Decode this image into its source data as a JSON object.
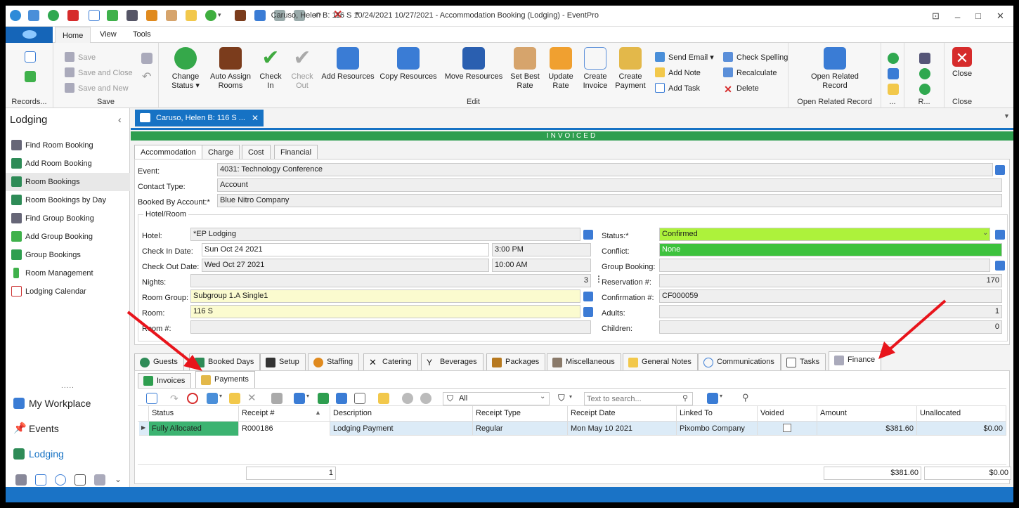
{
  "window": {
    "title": "Caruso, Helen B: 116 S 10/24/2021 10/27/2021  - Accommodation Booking (Lodging) - EventPro"
  },
  "ribbon_tabs": [
    "Home",
    "View",
    "Tools"
  ],
  "ribbon": {
    "groups": {
      "records": "Records...",
      "save": "Save",
      "edit": "Edit",
      "open_related": "Open Related Record",
      "g1": "...",
      "g2": "R...",
      "close": "Close"
    },
    "save": "Save",
    "save_close": "Save and Close",
    "save_new": "Save and New",
    "change_status": [
      "Change",
      "Status ▾"
    ],
    "auto_assign": [
      "Auto Assign",
      "Rooms"
    ],
    "check_in": [
      "Check",
      "In"
    ],
    "check_out": [
      "Check",
      "Out"
    ],
    "add_resources": "Add Resources",
    "copy_resources": "Copy Resources",
    "move_resources": "Move Resources",
    "set_best_rate": [
      "Set Best",
      "Rate"
    ],
    "update_rate": [
      "Update",
      "Rate"
    ],
    "create_invoice": [
      "Create",
      "Invoice"
    ],
    "create_payment": [
      "Create",
      "Payment"
    ],
    "send_email": "Send Email ▾",
    "add_note": "Add Note",
    "add_task": "Add Task",
    "check_spelling": "Check Spelling",
    "recalculate": "Recalculate",
    "delete": "Delete",
    "open_related": [
      "Open Related",
      "Record"
    ],
    "close": "Close"
  },
  "sidebar": {
    "title": "Lodging",
    "items": [
      "Find Room Booking",
      "Add Room Booking",
      "Room Bookings",
      "Room Bookings by Day",
      "Find Group Booking",
      "Add Group Booking",
      "Group Bookings",
      "Room Management",
      "Lodging Calendar"
    ],
    "nav": [
      "My Workplace",
      "Events",
      "Lodging"
    ],
    "grip": "....."
  },
  "doc_tab": {
    "label": "Caruso, Helen B: 116 S ...",
    "status_banner": "INVOICED"
  },
  "section_tabs": [
    "Accommodation",
    "Charge",
    "Cost",
    "Financial"
  ],
  "form": {
    "event_label": "Event:",
    "event": "4031: Technology Conference",
    "contact_type_label": "Contact Type:",
    "contact_type": "Account",
    "booked_by_label": "Booked By Account:*",
    "booked_by": "Blue Nitro Company",
    "hotel_room_group": "Hotel/Room",
    "hotel_label": "Hotel:",
    "hotel": "*EP Lodging",
    "checkin_label": "Check In Date:",
    "checkin_date": "Sun Oct 24 2021",
    "checkin_time": "3:00 PM",
    "checkout_label": "Check Out Date:",
    "checkout_date": "Wed Oct 27 2021",
    "checkout_time": "10:00 AM",
    "nights_label": "Nights:",
    "nights": "3",
    "room_group_label": "Room Group:",
    "room_group": "Subgroup 1.A Single1",
    "room_label": "Room:",
    "room": "116 S",
    "room_num_label": "Room #:",
    "room_num": "",
    "status_label": "Status:*",
    "status": "Confirmed",
    "conflict_label": "Conflict:",
    "conflict": "None",
    "group_booking_label": "Group Booking:",
    "group_booking": "",
    "reservation_label": "Reservation #:",
    "reservation": "170",
    "confirmation_label": "Confirmation #:",
    "confirmation": "CF000059",
    "adults_label": "Adults:",
    "adults": "1",
    "children_label": "Children:",
    "children": "0"
  },
  "feature_tabs": [
    "Guests",
    "Booked Days",
    "Setup",
    "Staffing",
    "Catering",
    "Beverages",
    "Packages",
    "Miscellaneous",
    "General Notes",
    "Communications",
    "Tasks",
    "Finance"
  ],
  "finance_tabs": [
    "Invoices",
    "Payments"
  ],
  "toolbar": {
    "filter": "All",
    "search_placeholder": "Text to search..."
  },
  "grid": {
    "columns": [
      "Status",
      "Receipt #",
      "Description",
      "Receipt Type",
      "Receipt Date",
      "Linked To",
      "Voided",
      "Amount",
      "Unallocated"
    ],
    "row": {
      "status": "Fully Allocated",
      "receipt": "R000186",
      "description": "Lodging Payment",
      "type": "Regular",
      "date": "Mon May 10 2021",
      "linked": "Pixombo Company",
      "voided": false,
      "amount": "$381.60",
      "unallocated": "$0.00"
    },
    "footer": {
      "count": "1",
      "amount": "$381.60",
      "unallocated": "$0.00"
    }
  },
  "colors": {
    "accent": "#1672c4",
    "invoiced": "#2e9e4f",
    "status_confirmed": "#adf23b",
    "conflict_none": "#3dc23d",
    "fully_allocated": "#3cb371",
    "arrow": "#e8141b"
  }
}
